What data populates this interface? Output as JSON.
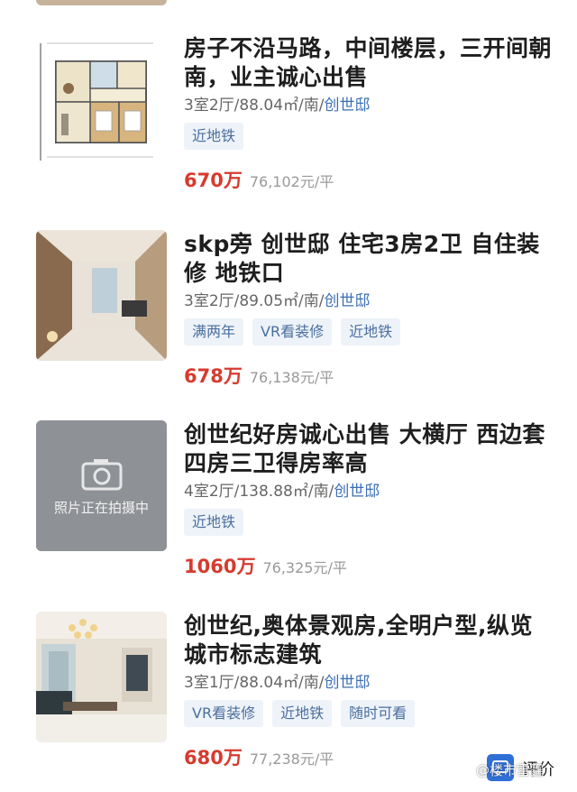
{
  "listings": [
    {
      "title": "房子不沿马路，中间楼层，三开间朝南，业主诚心出售",
      "meta_prefix": "3室2厅/88.04㎡/南/",
      "community": "创世邸",
      "tags": [
        "近地铁"
      ],
      "price": "670万",
      "unit_price": "76,102元/平",
      "image": "floor-plan"
    },
    {
      "title": "skp旁 创世邸 住宅3房2卫 自住装修 地铁口",
      "meta_prefix": "3室2厅/89.05㎡/南/",
      "community": "创世邸",
      "tags": [
        "满两年",
        "VR看装修",
        "近地铁"
      ],
      "price": "678万",
      "unit_price": "76,138元/平",
      "image": "living-room"
    },
    {
      "title": "创世纪好房诚心出售 大横厅 西边套 四房三卫得房率高",
      "meta_prefix": "4室2厅/138.88㎡/南/",
      "community": "创世邸",
      "tags": [
        "近地铁"
      ],
      "price": "1060万",
      "unit_price": "76,325元/平",
      "image": "photo-placeholder",
      "image_caption": "照片正在拍摄中"
    },
    {
      "title": "创世纪,奥体景观房,全明户型,纵览城市标志建筑",
      "meta_prefix": "3室1厅/88.04㎡/南/",
      "community": "创世邸",
      "tags": [
        "VR看装修",
        "近地铁",
        "随时可看"
      ],
      "price": "680万",
      "unit_price": "77,238元/平",
      "image": "living-room-chandelier"
    }
  ],
  "floating_button": {
    "label": "评价"
  },
  "watermark": "@楼市雷霆",
  "colors": {
    "price": "#d63b2f",
    "community_link": "#3b6fb6",
    "tag_bg": "#eef3f9",
    "tag_text": "#4a6f9e",
    "title": "#1e1e1e"
  }
}
